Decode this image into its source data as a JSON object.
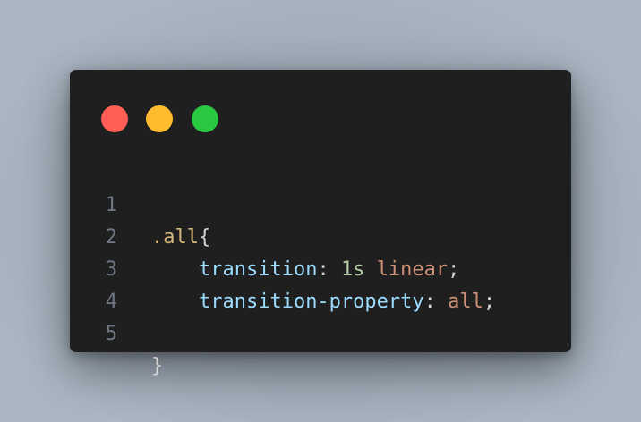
{
  "colors": {
    "background": "#a9b6c2",
    "window": "#1f1f1f",
    "close": "#ff5f57",
    "minimize": "#febc2e",
    "maximize": "#28c840",
    "line_number": "#6e7681",
    "selector": "#d7ba7d",
    "property": "#9cdcfe",
    "number": "#b5cea8",
    "value": "#ce9178",
    "punctuation": "#d4d4d4"
  },
  "window": {
    "controls": [
      "close-dot",
      "minimize-dot",
      "maximize-dot"
    ]
  },
  "code": {
    "line_numbers": [
      "1",
      "2",
      "3",
      "4",
      "5"
    ],
    "line1": {
      "selector": ".all",
      "brace_open": "{"
    },
    "line2": {
      "indent": "    ",
      "property": "transition",
      "colon": ": ",
      "number": "1s",
      "space": " ",
      "value": "linear",
      "semicolon": ";"
    },
    "line3": {
      "indent": "    ",
      "property": "transition-property",
      "colon": ": ",
      "value": "all",
      "semicolon": ";"
    },
    "line4": {
      "text": ""
    },
    "line5": {
      "brace_close": "}"
    }
  }
}
